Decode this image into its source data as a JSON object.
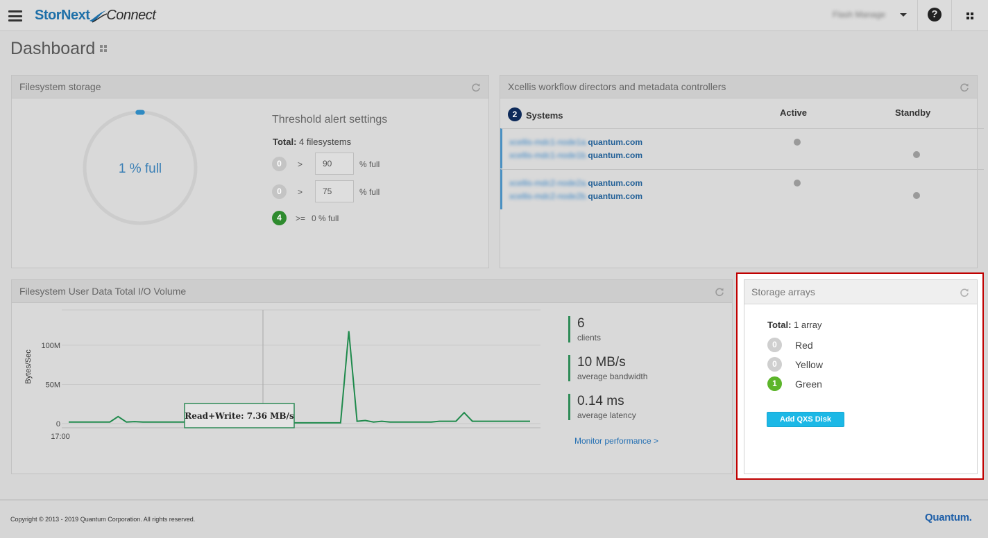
{
  "app": {
    "brand_main": "StorNext",
    "brand_sub": "Connect",
    "user_name": "Flash Manage",
    "help_label": "?"
  },
  "page": {
    "title": "Dashboard"
  },
  "filesystem_storage": {
    "header": "Filesystem storage",
    "usage_label": "1 % full",
    "usage_fraction": 0.01,
    "threshold_title": "Threshold alert settings",
    "total_label": "Total:",
    "total_value": "4 filesystems",
    "rows": [
      {
        "count": "0",
        "op": ">",
        "value": "90",
        "unit": "% full"
      },
      {
        "count": "0",
        "op": ">",
        "value": "75",
        "unit": "% full"
      },
      {
        "count": "4",
        "op": ">=",
        "value": "0 % full"
      }
    ]
  },
  "xcellis": {
    "header": "Xcellis workflow directors and metadata controllers",
    "systems_count": "2",
    "systems_label": "Systems",
    "col_active": "Active",
    "col_standby": "Standby",
    "groups": [
      {
        "hosts": [
          {
            "prefix": "xcellis-mdc1-node1a.",
            "domain": "quantum.com"
          },
          {
            "prefix": "xcellis-mdc1-node1b.",
            "domain": "quantum.com"
          }
        ]
      },
      {
        "hosts": [
          {
            "prefix": "xcellis-mdc2-node2a.",
            "domain": "quantum.com"
          },
          {
            "prefix": "xcellis-mdc2-node2b.",
            "domain": "quantum.com"
          }
        ]
      }
    ]
  },
  "io_volume": {
    "header": "Filesystem User Data Total I/O Volume",
    "tooltip": "Read+Write: 7.36 MB/s",
    "stats": [
      {
        "value": "6",
        "label": "clients"
      },
      {
        "value": "10 MB/s",
        "label": "average bandwidth"
      },
      {
        "value": "0.14 ms",
        "label": "average latency"
      }
    ],
    "monitor_link": "Monitor performance >"
  },
  "chart_data": {
    "type": "line",
    "ylabel": "Bytes/Sec",
    "xlabel": "",
    "x_tick_labels": [
      "17:00"
    ],
    "y_tick_labels": [
      "0",
      "50M",
      "100M"
    ],
    "y_ticks": [
      0,
      50,
      100
    ],
    "ylim": [
      0,
      145
    ],
    "xlim": [
      0,
      60
    ],
    "grid": true,
    "tooltip_index": 23,
    "series": [
      {
        "values": [
          2,
          2,
          2,
          2,
          2,
          2,
          9,
          2,
          2.5,
          2,
          2,
          2,
          2,
          2,
          2,
          2,
          2,
          2,
          3,
          2,
          9,
          3,
          5,
          1,
          1,
          1,
          6,
          1,
          1,
          1,
          1,
          1,
          1,
          1,
          118,
          3,
          4,
          2,
          3,
          2,
          2,
          2,
          2,
          2,
          2,
          3,
          3,
          3,
          14,
          3,
          3,
          3,
          3,
          3,
          3,
          3,
          3
        ]
      }
    ]
  },
  "storage_arrays": {
    "header": "Storage arrays",
    "total_label": "Total:",
    "total_value": "1 array",
    "statuses": [
      {
        "count": "0",
        "label": "Red"
      },
      {
        "count": "0",
        "label": "Yellow"
      },
      {
        "count": "1",
        "label": "Green"
      }
    ],
    "add_button": "Add QXS Disk"
  },
  "footer": {
    "copyright": "Copyright © 2013 - 2019 Quantum Corporation. All rights reserved.",
    "logo": "Quantum."
  },
  "colors": {
    "accent_blue": "#2570b3",
    "status_green": "#2e8b2e",
    "button_cyan": "#1cb8e6",
    "highlight_red": "#c00000",
    "chart_line": "#1f8a4c"
  },
  "icons": [
    "hamburger-icon",
    "help-icon",
    "apps-grid-icon",
    "refresh-icon"
  ]
}
